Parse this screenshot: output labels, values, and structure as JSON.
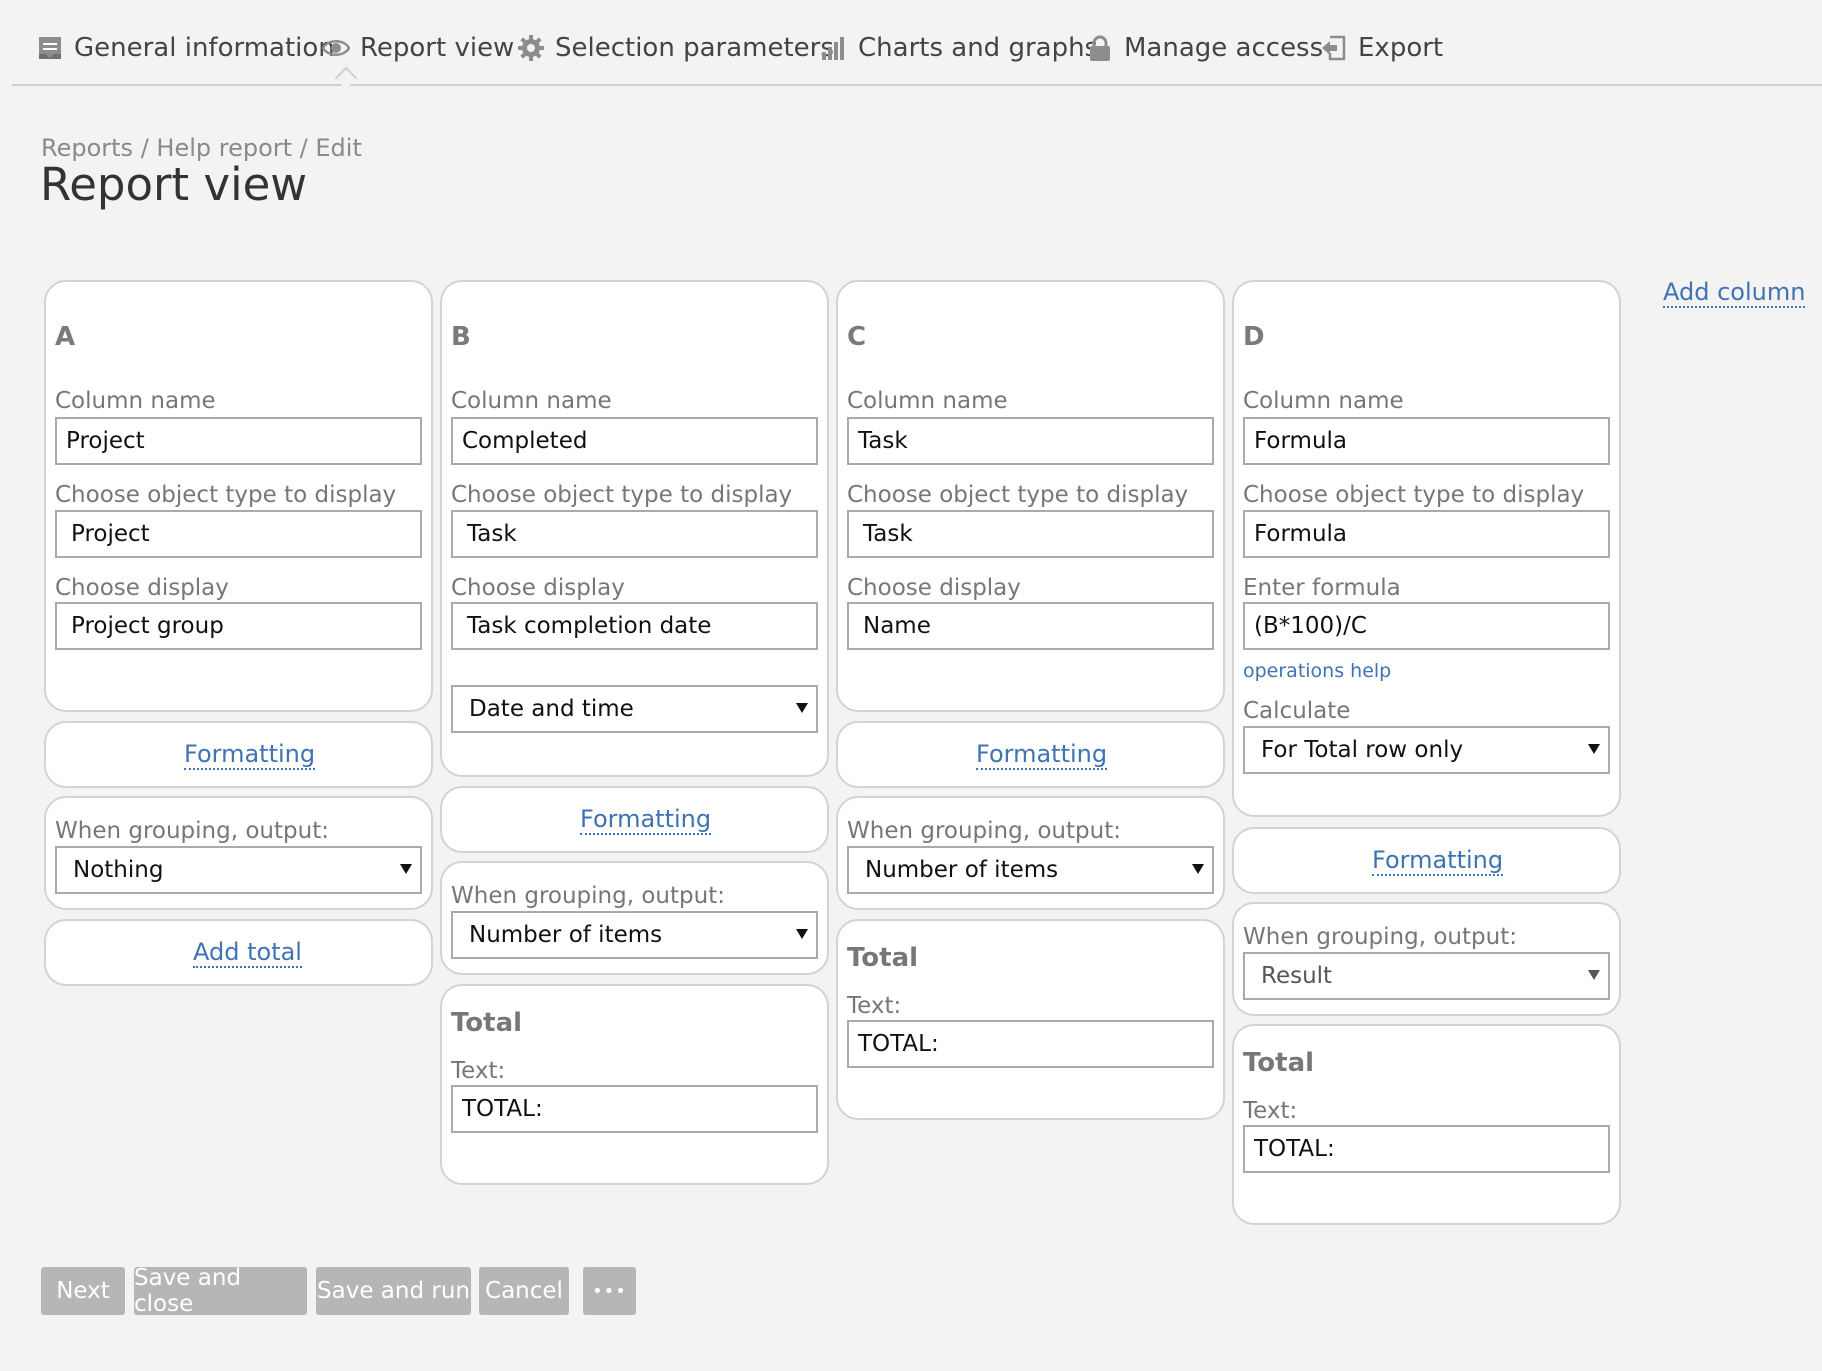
{
  "nav": {
    "items": [
      {
        "label": "General information",
        "icon": "document-icon"
      },
      {
        "label": "Report view",
        "icon": "eye-icon"
      },
      {
        "label": "Selection parameters",
        "icon": "gear-icon"
      },
      {
        "label": "Charts and graphs",
        "icon": "bar-chart-icon"
      },
      {
        "label": "Manage access",
        "icon": "lock-icon"
      },
      {
        "label": "Export",
        "icon": "export-icon"
      }
    ],
    "active": "Report view"
  },
  "breadcrumb": "Reports / Help report / Edit",
  "page_title": "Report view",
  "add_column_label": "Add column",
  "labels": {
    "column_name": "Column name",
    "object_type": "Choose object type to display",
    "display": "Choose display",
    "formula": "Enter formula",
    "operations_help": "operations help",
    "calculate": "Calculate",
    "formatting": "Formatting",
    "grouping": "When grouping, output:",
    "add_total": "Add total",
    "total_title": "Total",
    "total_text": "Text:"
  },
  "columns": {
    "a": {
      "letter": "A",
      "name": "Project",
      "object_type": "Project",
      "display": "Project group",
      "grouping": "Nothing"
    },
    "b": {
      "letter": "B",
      "name": "Completed",
      "object_type": "Task",
      "display": "Task completion date",
      "date_format": "Date and time",
      "grouping": "Number of items",
      "total_text": "TOTAL:"
    },
    "c": {
      "letter": "C",
      "name": "Task",
      "object_type": "Task",
      "display": "Name",
      "grouping": "Number of items",
      "total_text": "TOTAL:"
    },
    "d": {
      "letter": "D",
      "name": "Formula",
      "object_type": "Formula",
      "formula": "(B*100)/C",
      "calculate": "For Total row only",
      "grouping": "Result",
      "total_text": "TOTAL:"
    }
  },
  "buttons": {
    "next": "Next",
    "save_close": "Save and close",
    "save_run": "Save and run",
    "cancel": "Cancel",
    "more": "•••"
  },
  "colors": {
    "link": "#3f73b4",
    "button": "#b6b6b6",
    "background": "#f3f3f3"
  }
}
